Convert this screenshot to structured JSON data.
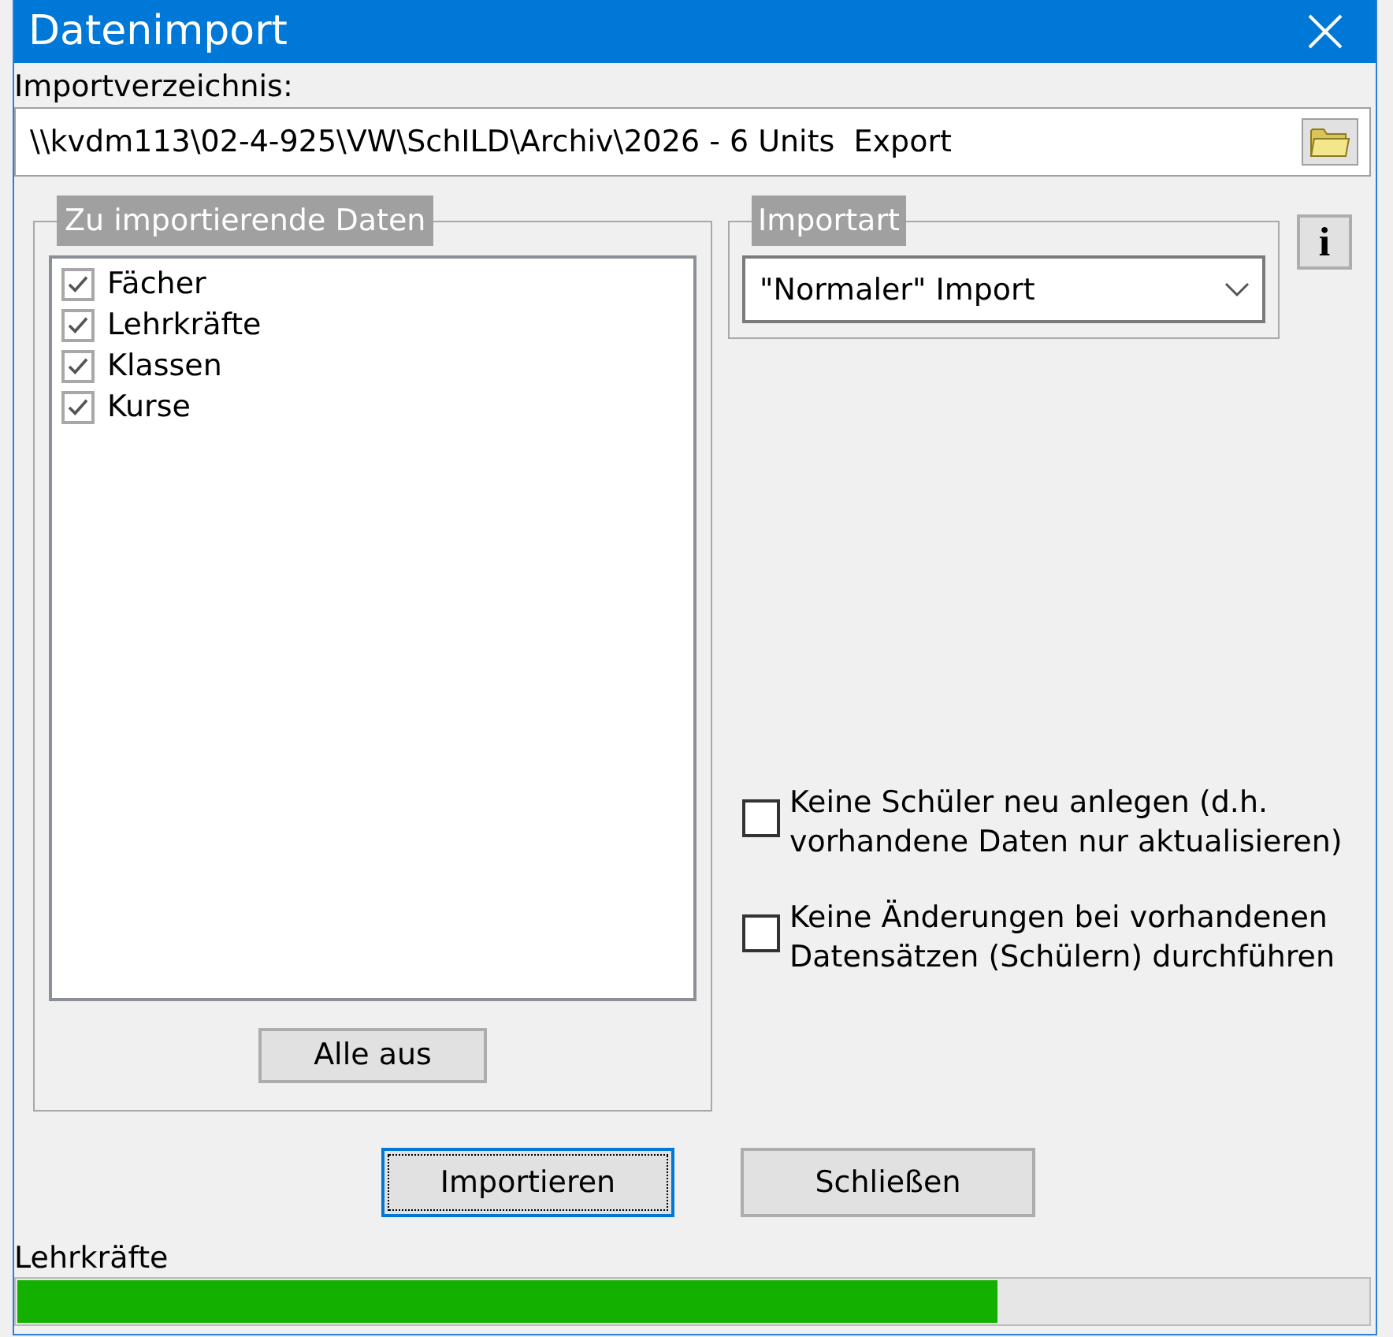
{
  "window": {
    "title": "Datenimport"
  },
  "import_directory": {
    "label": "Importverzeichnis:",
    "value": "\\\\kvdm113\\02-4-925\\VW\\SchILD\\Archiv\\2026 - 6 Units  Export"
  },
  "data_group": {
    "legend": "Zu importierende Daten",
    "items": [
      {
        "label": "Fächer",
        "checked": true
      },
      {
        "label": "Lehrkräfte",
        "checked": true
      },
      {
        "label": "Klassen",
        "checked": true
      },
      {
        "label": "Kurse",
        "checked": true
      }
    ],
    "button": "Alle aus"
  },
  "import_type": {
    "legend": "Importart",
    "value": "\"Normaler\" Import"
  },
  "info_button": {
    "label": "i"
  },
  "options": [
    {
      "label": "Keine Schüler neu anlegen (d.h. vorhandene Daten nur aktualisieren)",
      "checked": false
    },
    {
      "label": "Keine Änderungen bei vorhandenen Datensätzen (Schülern) durchführen",
      "checked": false
    }
  ],
  "buttons": [
    {
      "label": "Importieren",
      "focused": true
    },
    {
      "label": "Schließen",
      "focused": false
    }
  ],
  "progress": {
    "label": "Lehrkräfte",
    "level": 0.726
  }
}
